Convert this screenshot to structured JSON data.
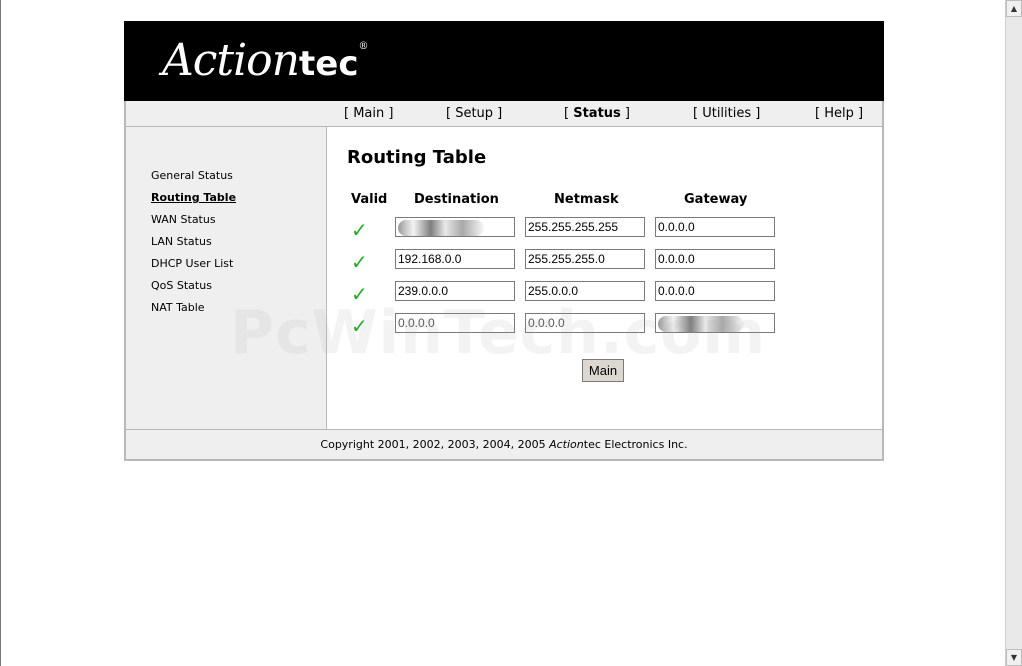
{
  "brand": {
    "logo_main": "Action",
    "logo_tec": "tec",
    "logo_reg": "®"
  },
  "nav": {
    "items": [
      {
        "label": "[ Main ]",
        "bold": false
      },
      {
        "label_pre": "[ ",
        "label": "Status",
        "label_post": " ]",
        "bold": true
      },
      {
        "label": "[ Setup ]",
        "bold": false
      },
      {
        "label": "[ Utilities ]",
        "bold": false
      },
      {
        "label": "[ Help ]",
        "bold": false
      }
    ]
  },
  "sidebar": {
    "items": [
      {
        "label": "General Status"
      },
      {
        "label": "Routing Table"
      },
      {
        "label": "WAN Status"
      },
      {
        "label": "LAN Status"
      },
      {
        "label": "DHCP User List"
      },
      {
        "label": "QoS Status"
      },
      {
        "label": "NAT Table"
      }
    ]
  },
  "main": {
    "title": "Routing Table",
    "columns": {
      "valid": "Valid",
      "destination": "Destination",
      "netmask": "Netmask",
      "gateway": "Gateway"
    },
    "rows": [
      {
        "destination": "",
        "netmask": "255.255.255.255",
        "gateway": "0.0.0.0"
      },
      {
        "destination": "192.168.0.0",
        "netmask": "255.255.255.0",
        "gateway": "0.0.0.0"
      },
      {
        "destination": "239.0.0.0",
        "netmask": "255.0.0.0",
        "gateway": "0.0.0.0"
      },
      {
        "destination": "0.0.0.0",
        "netmask": "0.0.0.0",
        "gateway": ""
      }
    ],
    "main_button": "Main"
  },
  "footer": {
    "copyright_pre": "Copyright 2001, 2002, 2003, 2004, 2005 ",
    "copyright_brand": "Action",
    "copyright_post": "tec Electronics Inc."
  },
  "watermark": "PcWinTech.com",
  "colors": {
    "header_bg": "#000000",
    "panel_bg": "#efefef",
    "check": "#2aa82a"
  }
}
